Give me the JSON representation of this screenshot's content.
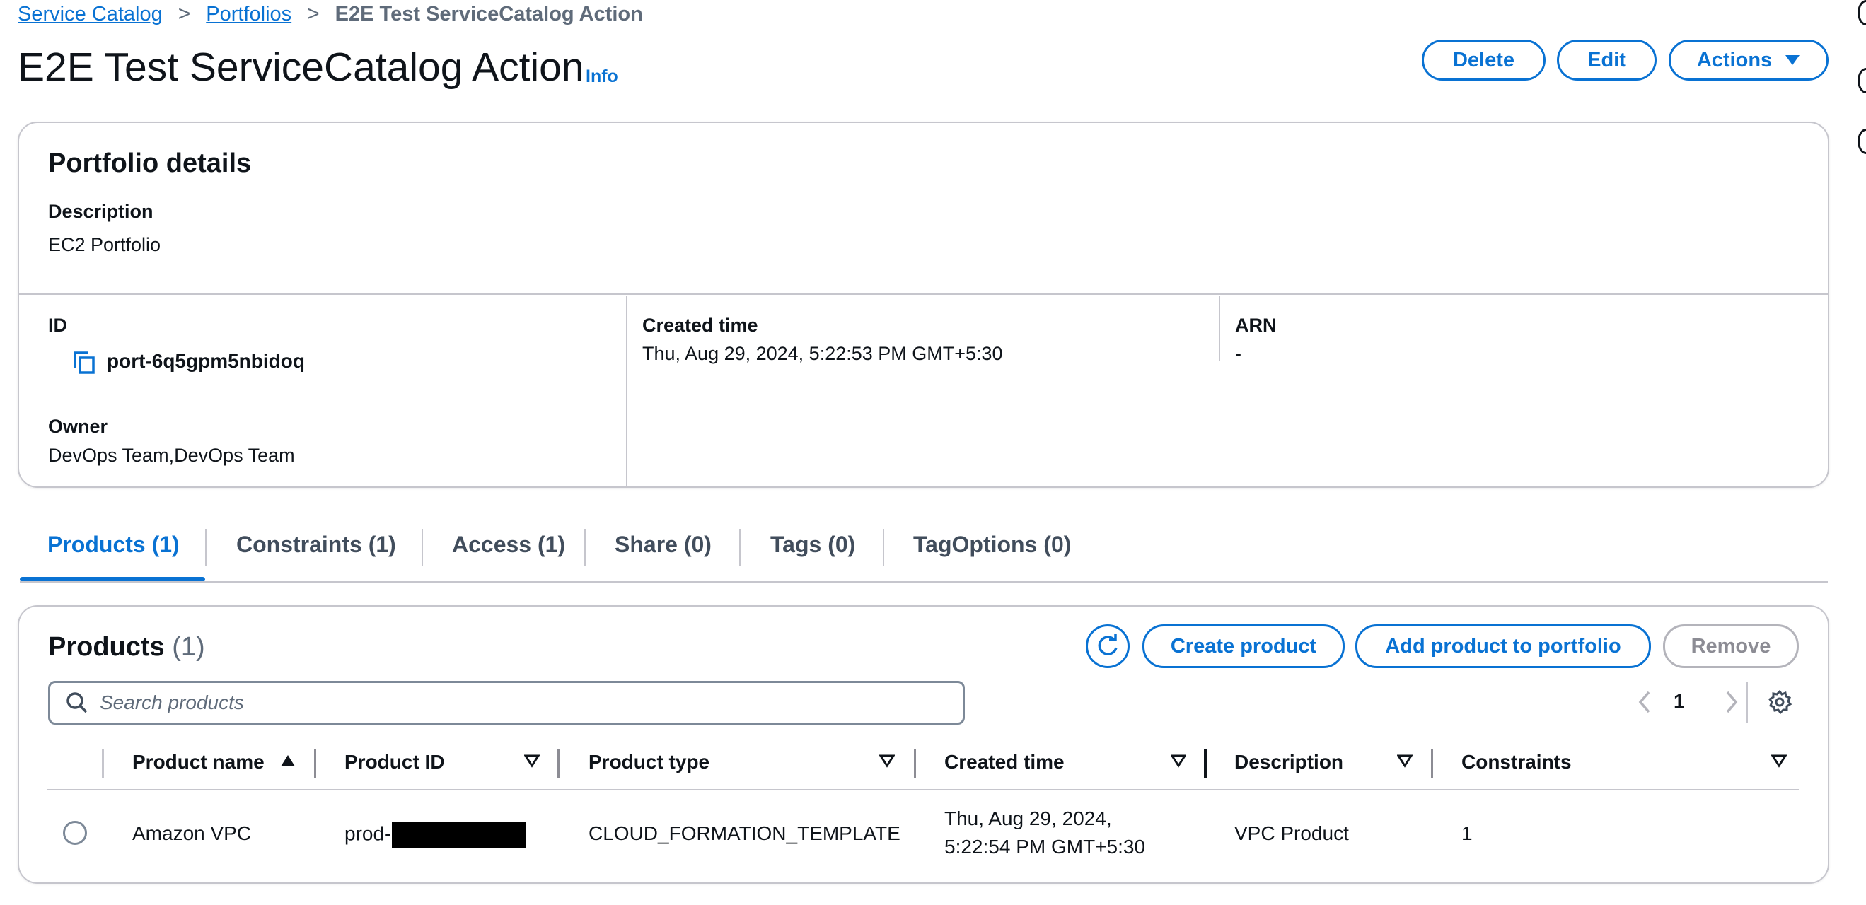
{
  "breadcrumb": {
    "items": [
      "Service Catalog",
      "Portfolios"
    ],
    "current": "E2E Test ServiceCatalog Action"
  },
  "header": {
    "title": "E2E Test ServiceCatalog Action",
    "info": "Info",
    "delete_label": "Delete",
    "edit_label": "Edit",
    "actions_label": "Actions"
  },
  "details": {
    "heading": "Portfolio details",
    "description_label": "Description",
    "description_value": "EC2 Portfolio",
    "id_label": "ID",
    "id_value": "port-6q5gpm5nbidoq",
    "created_label": "Created time",
    "created_value": "Thu, Aug 29, 2024, 5:22:53 PM GMT+5:30",
    "arn_label": "ARN",
    "arn_value": "-",
    "owner_label": "Owner",
    "owner_value": "DevOps Team,DevOps Team"
  },
  "tabs": [
    {
      "label": "Products (1)",
      "active": true
    },
    {
      "label": "Constraints (1)"
    },
    {
      "label": "Access (1)"
    },
    {
      "label": "Share (0)"
    },
    {
      "label": "Tags (0)"
    },
    {
      "label": "TagOptions (0)"
    }
  ],
  "products": {
    "heading": "Products",
    "count": "(1)",
    "create_label": "Create product",
    "add_label": "Add product to portfolio",
    "remove_label": "Remove",
    "search_placeholder": "Search products",
    "page": "1",
    "columns": [
      "Product name",
      "Product ID",
      "Product type",
      "Created time",
      "Description",
      "Constraints"
    ],
    "rows": [
      {
        "name": "Amazon VPC",
        "id": "prod-",
        "type": "CLOUD_FORMATION_TEMPLATE",
        "created_line1": "Thu, Aug 29, 2024,",
        "created_line2": "5:22:54 PM GMT+5:30",
        "description": "VPC Product",
        "constraints": "1"
      }
    ]
  },
  "colors": {
    "accent": "#0972d3",
    "border": "#c6c6cd",
    "text": "#0f141a",
    "muted": "#5f6b7a",
    "disabled": "#8c8c94"
  },
  "icons": [
    "chevron-right-icon",
    "copy-icon",
    "caret-down-icon",
    "refresh-icon",
    "search-icon",
    "chevron-left-icon",
    "settings-icon",
    "sort-ascending-icon",
    "sort-icon",
    "radio-icon"
  ]
}
